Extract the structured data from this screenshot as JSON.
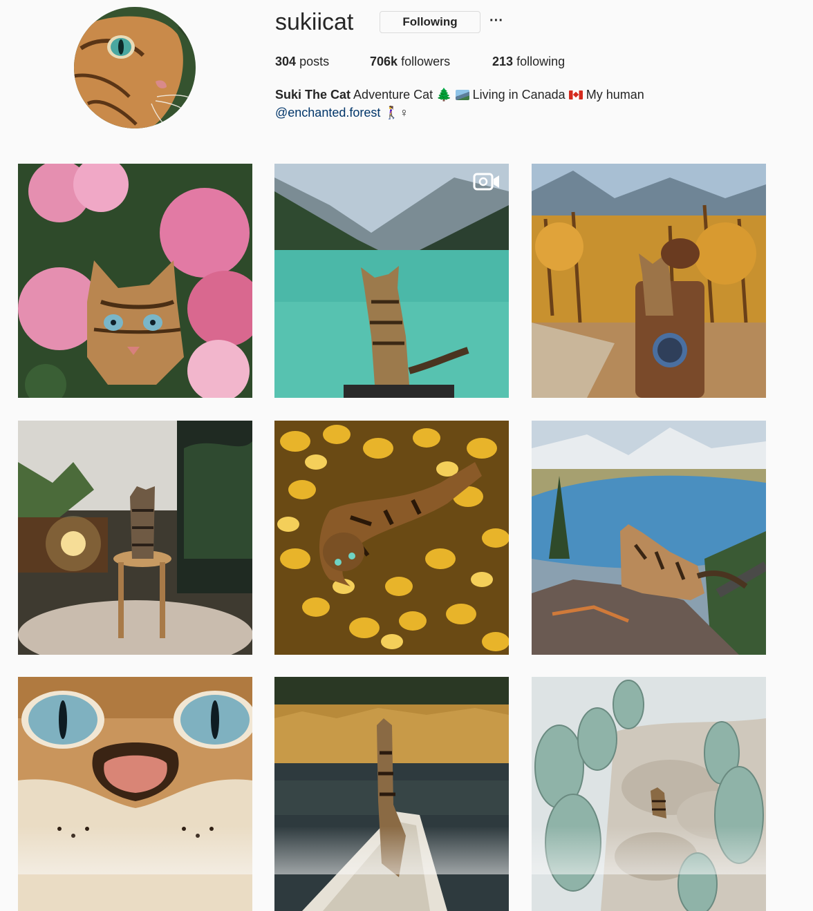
{
  "profile": {
    "username": "sukiicat",
    "follow_button_label": "Following",
    "more_options_label": "···",
    "avatar_icon": "cat-avatar"
  },
  "stats": {
    "posts_count": "304",
    "posts_label": "posts",
    "followers_count": "706k",
    "followers_label": "followers",
    "following_count": "213",
    "following_label": "following"
  },
  "bio": {
    "name": "Suki The Cat",
    "text_1": "Adventure Cat",
    "emoji_tree": "🌲",
    "text_2": "Living in Canada",
    "text_3": "My human",
    "mention": "@enchanted.forest",
    "emoji_end": "🚶‍♀️♀"
  },
  "posts": [
    {
      "subject": "cat-in-pink-flowers"
    },
    {
      "subject": "cat-at-turquoise-lake",
      "is_video": true
    },
    {
      "subject": "cat-on-backpack-autumn-forest"
    },
    {
      "subject": "cat-on-stool-among-plants"
    },
    {
      "subject": "cat-in-yellow-leaves"
    },
    {
      "subject": "cat-on-rock-above-lake"
    },
    {
      "subject": "cat-face-closeup"
    },
    {
      "subject": "cat-on-canoe-bow"
    },
    {
      "subject": "cat-among-cacti"
    }
  ],
  "colors": {
    "background": "#fafafa",
    "text": "#262626",
    "border": "#dbdbdb",
    "link": "#003569"
  }
}
